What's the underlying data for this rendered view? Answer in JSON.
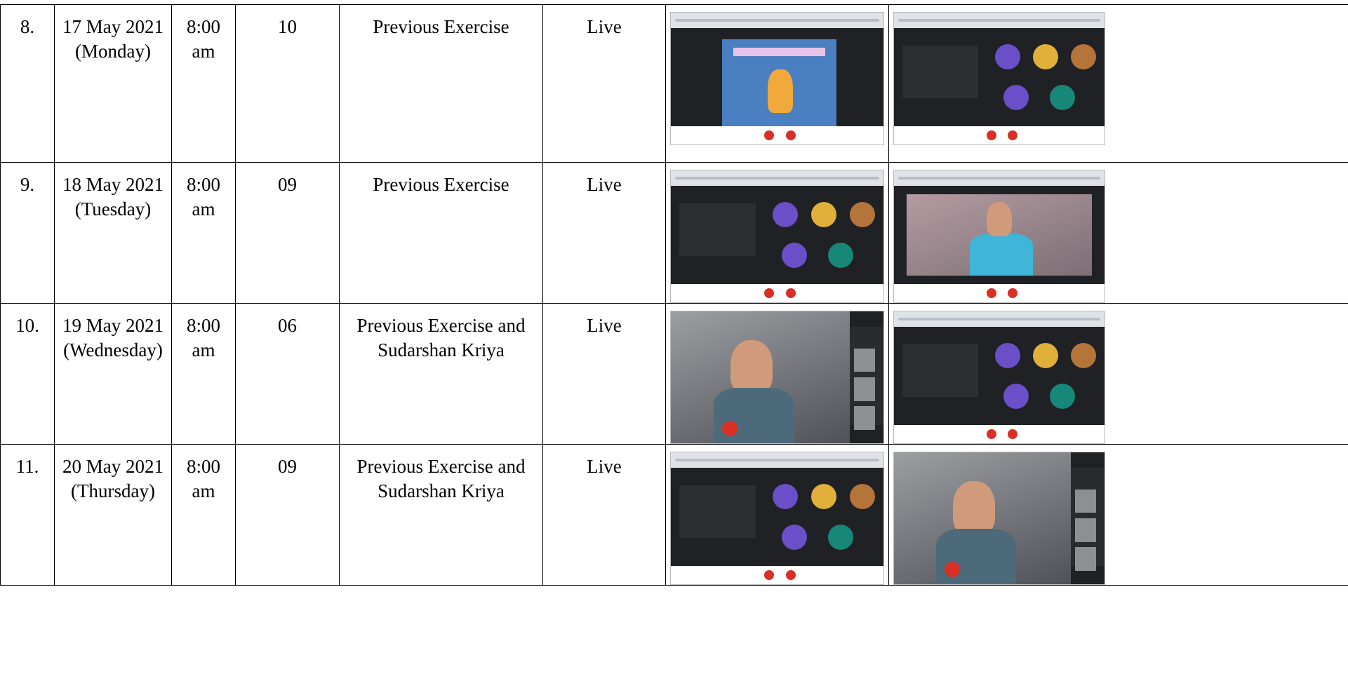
{
  "rows": [
    {
      "no": "8.",
      "date": "17 May 2021",
      "day": "(Monday)",
      "time": "8:00",
      "period": "am",
      "participants": "10",
      "activity_line1": "Previous Exercise",
      "activity_line2": "",
      "mode": "Live",
      "images": [
        {
          "icon": "meet-presentation-screenshot"
        },
        {
          "icon": "meet-participant-grid-screenshot"
        }
      ]
    },
    {
      "no": "9.",
      "date": "18 May 2021",
      "day": "(Tuesday)",
      "time": "8:00",
      "period": "am",
      "participants": "09",
      "activity_line1": "Previous Exercise",
      "activity_line2": "",
      "mode": "Live",
      "images": [
        {
          "icon": "meet-participant-grid-screenshot"
        },
        {
          "icon": "meet-instructor-video-screenshot"
        }
      ]
    },
    {
      "no": "10.",
      "date": "19 May 2021",
      "day": "(Wednesday)",
      "time": "8:00",
      "period": "am",
      "participants": "06",
      "activity_line1": "Previous Exercise and",
      "activity_line2": "Sudarshan Kriya",
      "mode": "Live",
      "images": [
        {
          "icon": "mobile-meet-video-screenshot"
        },
        {
          "icon": "meet-participant-grid-screenshot"
        }
      ]
    },
    {
      "no": "11.",
      "date": "20 May 2021",
      "day": "(Thursday)",
      "time": "8:00",
      "period": "am",
      "participants": "09",
      "activity_line1": "Previous Exercise and",
      "activity_line2": "Sudarshan Kriya",
      "mode": "Live",
      "images": [
        {
          "icon": "meet-participant-grid-screenshot"
        },
        {
          "icon": "mobile-meet-video-screenshot"
        }
      ]
    }
  ],
  "colors": {
    "border": "#000000",
    "meet_dark": "#202124",
    "record_red": "#d93025"
  }
}
